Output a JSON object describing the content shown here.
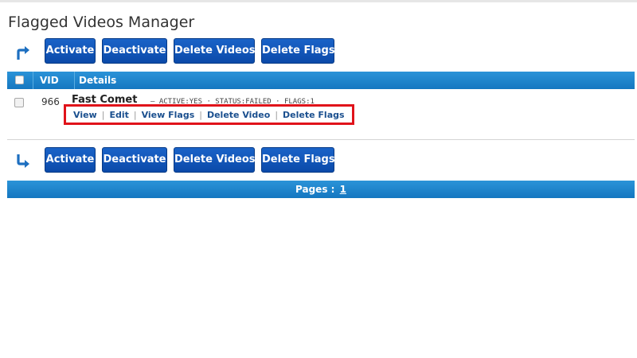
{
  "page": {
    "title": "Flagged Videos Manager"
  },
  "toolbar": {
    "activate_label": "Activate",
    "deactivate_label": "Deactivate",
    "delete_videos_label": "Delete Videos",
    "delete_flags_label": "Delete Flags",
    "top_icon": "arrow-turn-up-right-icon",
    "bottom_icon": "arrow-turn-down-right-icon",
    "accent_color": "#0b4aa9"
  },
  "table": {
    "header_color": "#1e84cc",
    "columns": {
      "vid": "VID",
      "details": "Details"
    },
    "rows": [
      {
        "vid": "966",
        "title": "Fast Comet",
        "meta": "— ACTIVE:YES · STATUS:FAILED · FLAGS:1",
        "actions": {
          "view": "View",
          "edit": "Edit",
          "view_flags": "View Flags",
          "delete_video": "Delete Video",
          "delete_flags": "Delete Flags"
        },
        "highlight_color": "#e0131a"
      }
    ]
  },
  "pagination": {
    "label": "Pages :",
    "current_page": "1"
  }
}
